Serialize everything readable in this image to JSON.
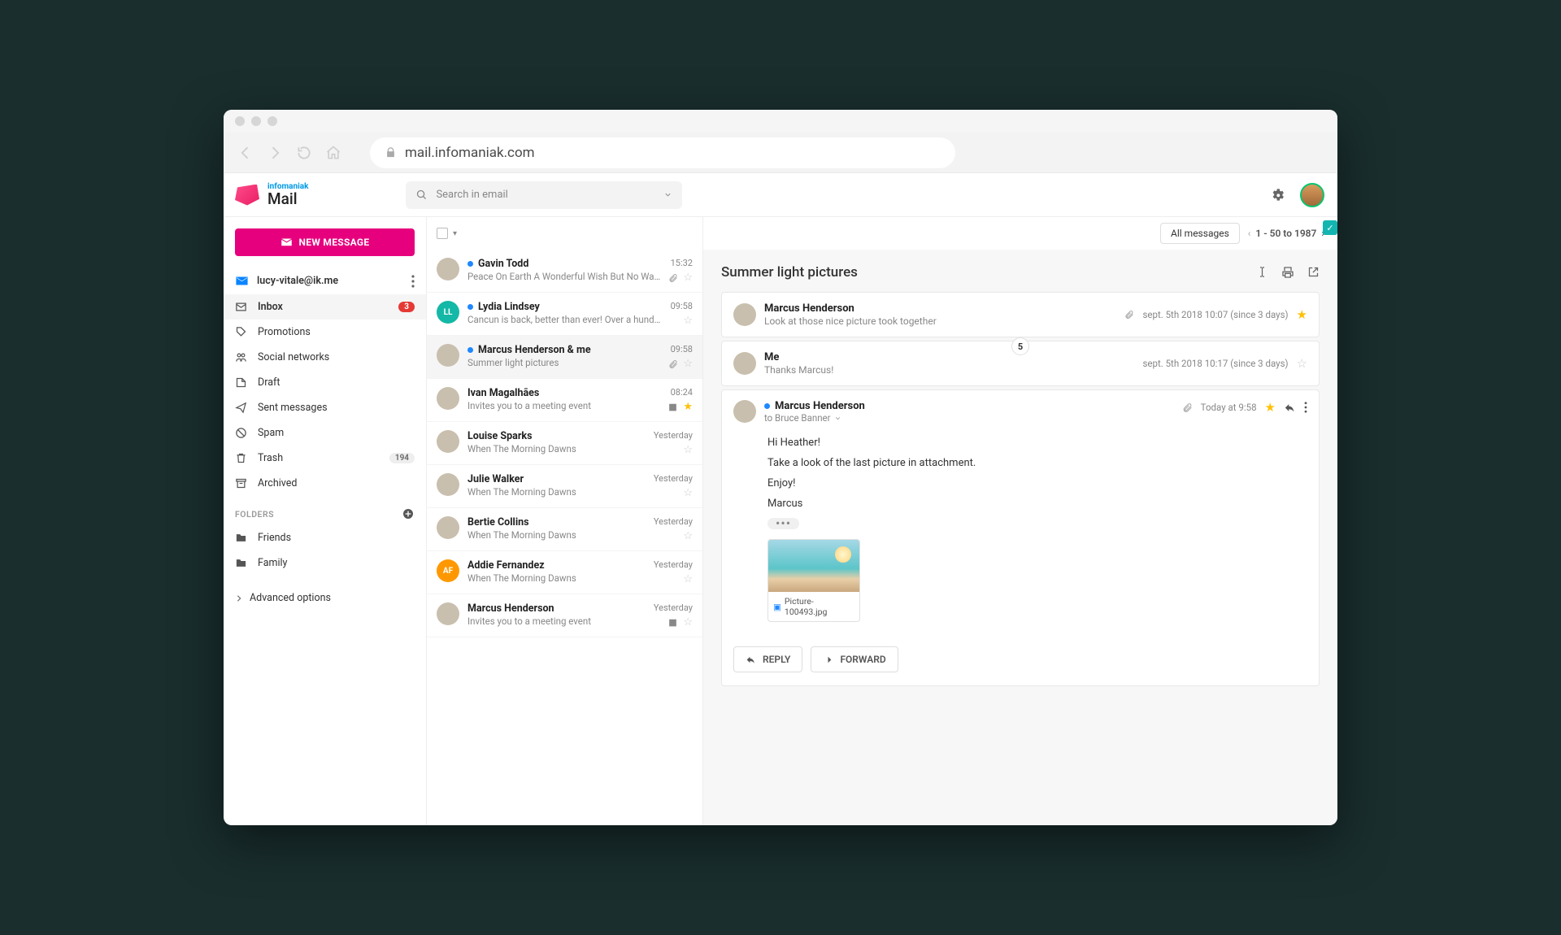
{
  "browser": {
    "url": "mail.infomaniak.com"
  },
  "brand": {
    "top": "infomaniak",
    "bottom": "Mail"
  },
  "search": {
    "placeholder": "Search in email"
  },
  "compose": {
    "label": "NEW MESSAGE"
  },
  "account": {
    "email": "lucy-vitale@ik.me"
  },
  "nav": {
    "inbox": "Inbox",
    "inbox_badge": "3",
    "promotions": "Promotions",
    "social": "Social networks",
    "draft": "Draft",
    "sent": "Sent messages",
    "spam": "Spam",
    "trash": "Trash",
    "trash_badge": "194",
    "archived": "Archived"
  },
  "folders": {
    "title": "FOLDERS",
    "items": [
      "Friends",
      "Family"
    ]
  },
  "advanced": "Advanced options",
  "listToolbar": {
    "allMessages": "All messages",
    "pager": "1 - 50 to 1987"
  },
  "messages": [
    {
      "sender": "Gavin Todd",
      "preview": "Peace On Earth A Wonderful Wish But No Way…",
      "time": "15:32",
      "unread": true,
      "clip": true
    },
    {
      "sender": "Lydia Lindsey",
      "preview": "Cancun is back, better than ever! Over a hundred…",
      "time": "09:58",
      "unread": true,
      "avatar": "teal",
      "initials": "LL"
    },
    {
      "sender": "Marcus Henderson & me",
      "preview": "Summer light pictures",
      "time": "09:58",
      "unread": true,
      "clip": true,
      "active": true
    },
    {
      "sender": "Ivan Magalhães",
      "preview": "Invites you to a meeting event",
      "time": "08:24",
      "star": true,
      "cal": true
    },
    {
      "sender": "Louise Sparks",
      "preview": "When The Morning Dawns",
      "time": "Yesterday"
    },
    {
      "sender": "Julie Walker",
      "preview": "When The Morning Dawns",
      "time": "Yesterday"
    },
    {
      "sender": "Bertie Collins",
      "preview": "When The Morning Dawns",
      "time": "Yesterday"
    },
    {
      "sender": "Addie Fernandez",
      "preview": "When The Morning Dawns",
      "time": "Yesterday",
      "avatar": "orange",
      "initials": "AF"
    },
    {
      "sender": "Marcus Henderson",
      "preview": "Invites you to a meeting event",
      "time": "Yesterday",
      "cal": true
    }
  ],
  "thread": {
    "subject": "Summer light pictures",
    "badge": "5",
    "items": [
      {
        "name": "Marcus Henderson",
        "preview": "Look at those nice picture took together",
        "meta": "sept. 5th 2018 10:07 (since 3 days)",
        "clip": true,
        "star": true
      },
      {
        "name": "Me",
        "preview": "Thanks Marcus!",
        "meta": "sept. 5th 2018 10:17 (since 3 days)"
      }
    ],
    "open": {
      "name": "Marcus Henderson",
      "to": "to Bruce Banner",
      "meta": "Today at 9:58",
      "body": [
        "Hi Heather!",
        "Take a look of the last picture in attachment.",
        "Enjoy!",
        "Marcus"
      ],
      "attachment": "Picture-100493.jpg"
    },
    "actions": {
      "reply": "REPLY",
      "forward": "FORWARD"
    }
  }
}
